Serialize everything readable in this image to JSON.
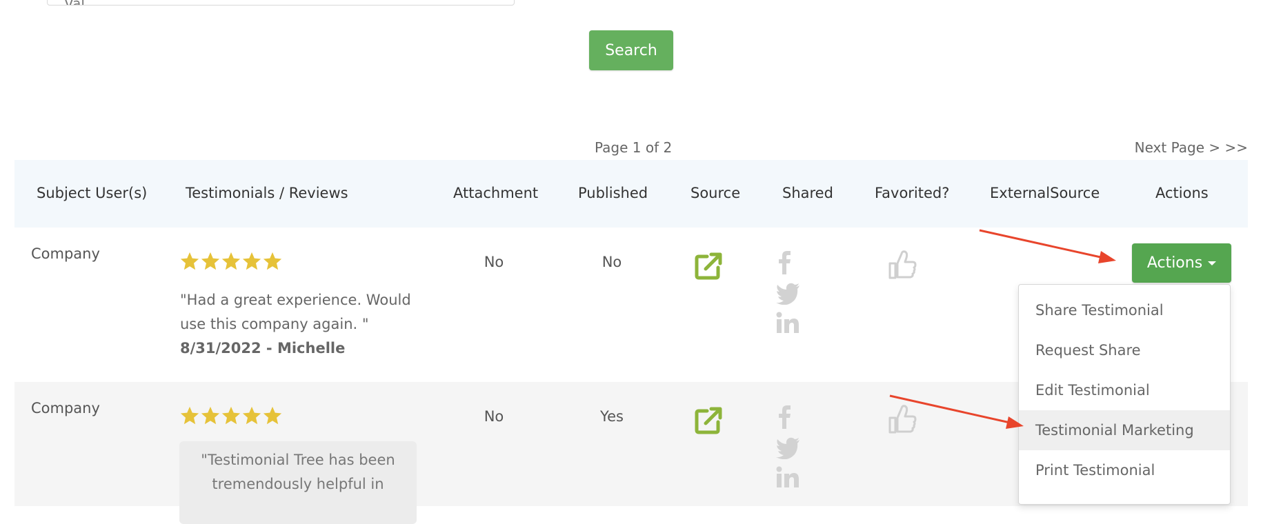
{
  "search": {
    "field_value": "Val",
    "button_label": "Search"
  },
  "pagination": {
    "page_info": "Page 1 of 2",
    "next_label": "Next Page > >>"
  },
  "table": {
    "headers": [
      "Subject User(s)",
      "Testimonials / Reviews",
      "Attachment",
      "Published",
      "Source",
      "Shared",
      "Favorited?",
      "ExternalSource",
      "Actions"
    ],
    "rows": [
      {
        "subject": "Company",
        "rating": 5,
        "review_line1": "\"Had a great experience. Would",
        "review_line2": "use this company again. \"",
        "review_meta": "8/31/2022 - Michelle",
        "attachment": "No",
        "published": "No"
      },
      {
        "subject": "Company",
        "rating": 5,
        "review_line1": "\"Testimonial Tree has been",
        "review_line2": "tremendously helpful in",
        "attachment": "No",
        "published": "Yes"
      }
    ]
  },
  "actions": {
    "button_label": "Actions",
    "menu": [
      "Share Testimonial",
      "Request Share",
      "Edit Testimonial",
      "Testimonial Marketing",
      "Print Testimonial"
    ],
    "highlighted": "Testimonial Marketing"
  },
  "colors": {
    "accent_green": "#65b05e",
    "star_gold": "#e6c239",
    "source_icon": "#8db43a",
    "annotation_arrow": "#e8452c"
  }
}
